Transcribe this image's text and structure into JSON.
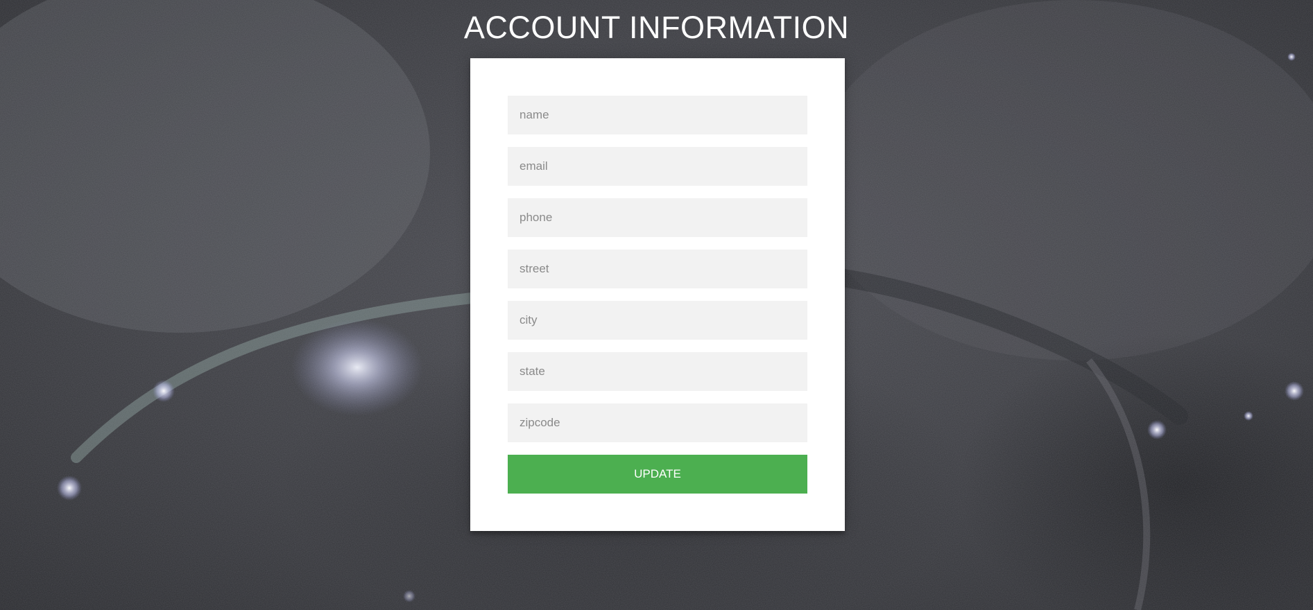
{
  "page": {
    "title": "ACCOUNT INFORMATION"
  },
  "form": {
    "fields": [
      {
        "name": "name",
        "placeholder": "name",
        "value": ""
      },
      {
        "name": "email",
        "placeholder": "email",
        "value": ""
      },
      {
        "name": "phone",
        "placeholder": "phone",
        "value": ""
      },
      {
        "name": "street",
        "placeholder": "street",
        "value": ""
      },
      {
        "name": "city",
        "placeholder": "city",
        "value": ""
      },
      {
        "name": "state",
        "placeholder": "state",
        "value": ""
      },
      {
        "name": "zipcode",
        "placeholder": "zipcode",
        "value": ""
      }
    ],
    "submit_label": "UPDATE"
  },
  "colors": {
    "button": "#4caf50",
    "field_background": "#f2f2f2",
    "card_background": "#ffffff",
    "title_text": "#ffffff"
  }
}
